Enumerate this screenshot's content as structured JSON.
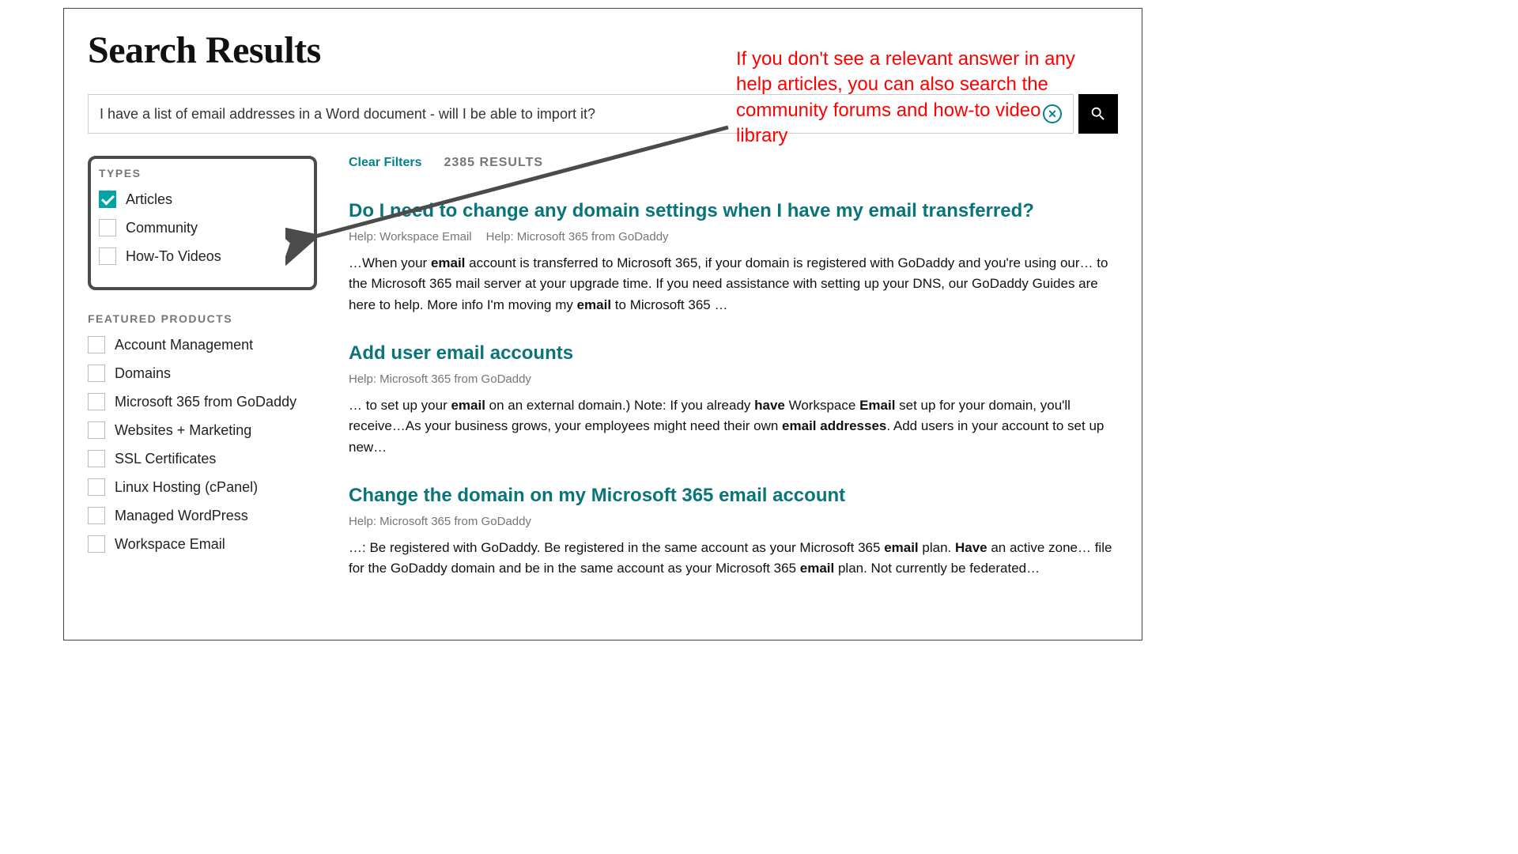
{
  "page": {
    "title": "Search Results"
  },
  "search": {
    "value": "I have a list of email addresses in a Word document - will I be able to import it?"
  },
  "meta": {
    "clear_filters": "Clear Filters",
    "result_count": "2385 RESULTS"
  },
  "filters": {
    "types_heading": "TYPES",
    "types": [
      {
        "label": "Articles",
        "checked": true
      },
      {
        "label": "Community",
        "checked": false
      },
      {
        "label": "How-To Videos",
        "checked": false
      }
    ],
    "featured_heading": "FEATURED PRODUCTS",
    "featured": [
      {
        "label": "Account Management"
      },
      {
        "label": "Domains"
      },
      {
        "label": "Microsoft 365 from GoDaddy"
      },
      {
        "label": "Websites + Marketing"
      },
      {
        "label": "SSL Certificates"
      },
      {
        "label": "Linux Hosting (cPanel)"
      },
      {
        "label": "Managed WordPress"
      },
      {
        "label": "Workspace Email"
      }
    ]
  },
  "results": [
    {
      "title": "Do I need to change any domain settings when I have my email transferred?",
      "categories": [
        "Help: Workspace Email",
        "Help: Microsoft 365 from GoDaddy"
      ],
      "snippet_html": "…When your <b>email</b> account is transferred to Microsoft 365, if your domain is registered with GoDaddy and you're using our… to the Microsoft 365 mail server at your upgrade time. If you need assistance with setting up your DNS, our GoDaddy Guides are here to help. More info I'm moving my <b>email</b> to Microsoft 365 …"
    },
    {
      "title": "Add user email accounts",
      "categories": [
        "Help: Microsoft 365 from GoDaddy"
      ],
      "snippet_html": "… to set up your <b>email</b> on an external domain.) Note: If you already <b>have</b> Workspace <b>Email</b> set up for your domain, you'll receive…As your business grows, your employees might need their own <b>email addresses</b>. Add users in your account to set up new…"
    },
    {
      "title": "Change the domain on my Microsoft 365 email account",
      "categories": [
        "Help: Microsoft 365 from GoDaddy"
      ],
      "snippet_html": "…: Be registered with GoDaddy. Be registered in the same account as your Microsoft 365 <b>email</b> plan. <b>Have</b> an active zone… file for the GoDaddy domain and be in the same account as your Microsoft 365 <b>email</b> plan. Not currently be federated…"
    }
  ],
  "annotation": {
    "text": "If you don't see a relevant answer in any help articles, you can also search the community forums and how-to video library"
  }
}
